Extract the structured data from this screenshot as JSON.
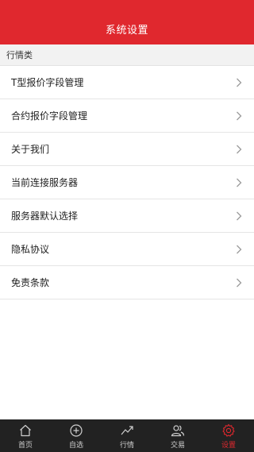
{
  "header": {
    "title": "系统设置"
  },
  "section": {
    "title": "行情类"
  },
  "list": {
    "items": [
      {
        "label": "T型报价字段管理",
        "icon": "chevron-right-icon"
      },
      {
        "label": "合约报价字段管理",
        "icon": "chevron-right-icon"
      },
      {
        "label": "关于我们",
        "icon": "chevron-right-icon"
      },
      {
        "label": "当前连接服务器",
        "icon": "chevron-right-icon"
      },
      {
        "label": "服务器默认选择",
        "icon": "chevron-right-icon"
      },
      {
        "label": "隐私协议",
        "icon": "chevron-right-icon"
      },
      {
        "label": "免责条款",
        "icon": "chevron-right-icon"
      }
    ]
  },
  "tabbar": {
    "tabs": [
      {
        "label": "首页",
        "icon": "home-icon",
        "active": false
      },
      {
        "label": "自选",
        "icon": "add-circle-icon",
        "active": false
      },
      {
        "label": "行情",
        "icon": "trend-chart-icon",
        "active": false
      },
      {
        "label": "交易",
        "icon": "users-icon",
        "active": false
      },
      {
        "label": "设置",
        "icon": "gear-icon",
        "active": true
      }
    ]
  },
  "colors": {
    "brand_red": "#e0282e",
    "tabbar_bg": "#222222",
    "section_bg": "#f2f2f2"
  }
}
